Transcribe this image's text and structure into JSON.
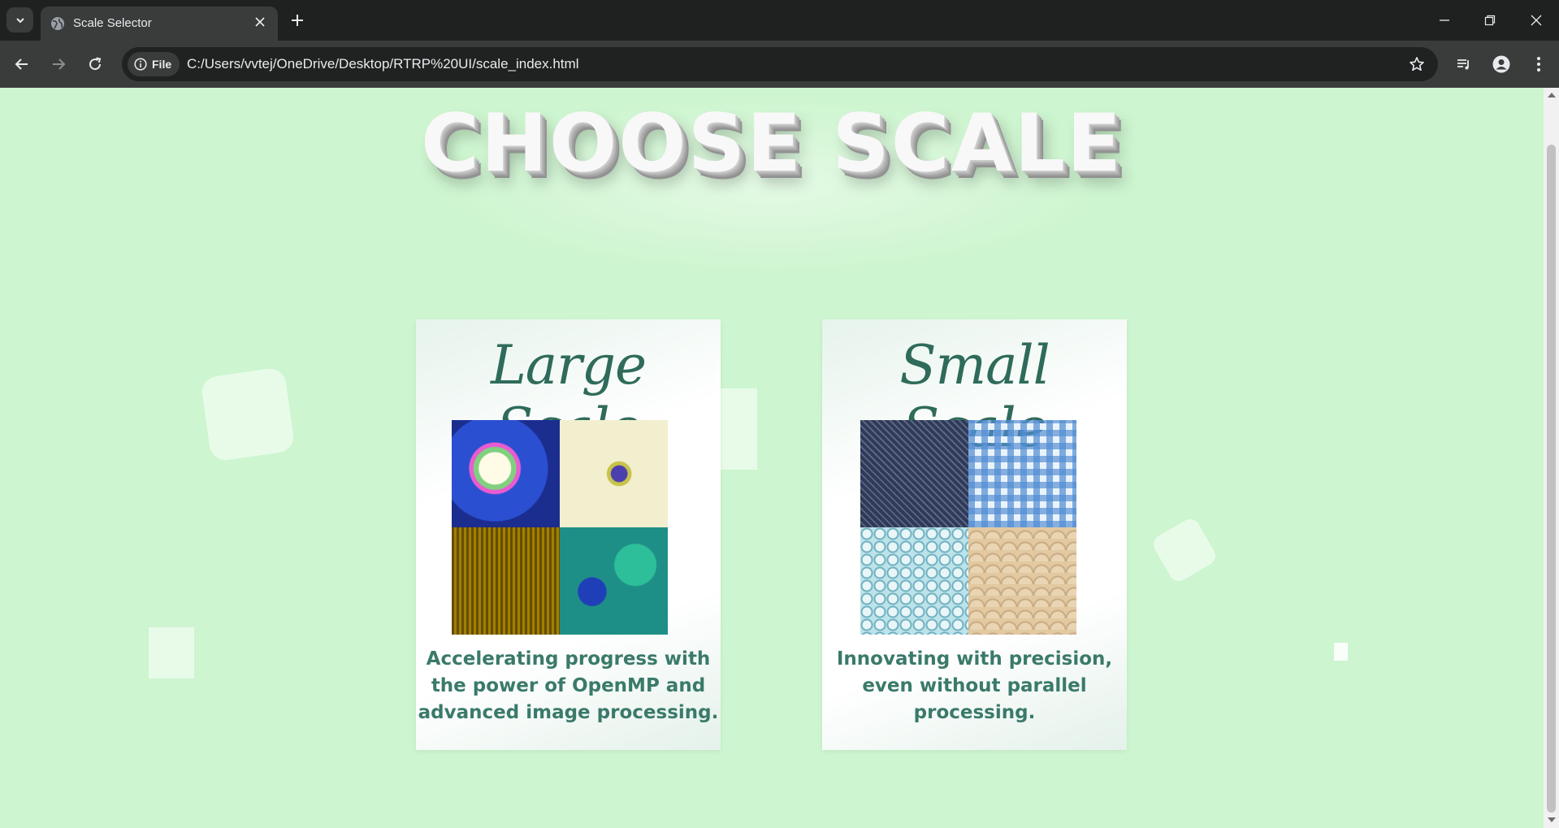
{
  "browser": {
    "tab_title": "Scale Selector",
    "security_chip_label": "File",
    "url": "C:/Users/vvtej/OneDrive/Desktop/RTRP%20UI/scale_index.html"
  },
  "page": {
    "heading": "CHOOSE SCALE",
    "cards": [
      {
        "title": "Large Scale",
        "caption_lines": [
          "Accelerating progress with",
          "the power of OpenMP and",
          "advanced image processing."
        ]
      },
      {
        "title": "Small Scale",
        "caption_lines": [
          "Innovating with precision,",
          "even without parallel",
          "processing."
        ]
      }
    ]
  },
  "colors": {
    "page_background": "#cdf5cf",
    "caption_text": "#3a7a6a",
    "title_script": "#2f6b5a"
  }
}
